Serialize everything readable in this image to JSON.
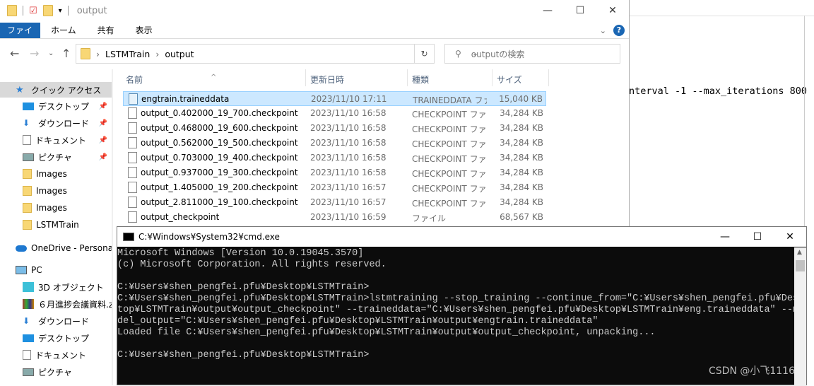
{
  "background_doc": {
    "text": "nterval -1 --max_iterations 800"
  },
  "explorer": {
    "title": "output",
    "ribbon_tabs": [
      "ファイル",
      "ホーム",
      "共有",
      "表示"
    ],
    "breadcrumb": [
      "LSTMTrain",
      "output"
    ],
    "search_placeholder": "outputの検索",
    "sidebar": [
      {
        "label": "クイック アクセス",
        "icon": "star-icon",
        "selected": true
      },
      {
        "label": "デスクトップ",
        "icon": "desktop-icon",
        "pinned": true
      },
      {
        "label": "ダウンロード",
        "icon": "download-icon",
        "pinned": true
      },
      {
        "label": "ドキュメント",
        "icon": "document-icon",
        "pinned": true
      },
      {
        "label": "ピクチャ",
        "icon": "picture-icon",
        "pinned": true
      },
      {
        "label": "Images",
        "icon": "folder-icon"
      },
      {
        "label": "Images",
        "icon": "folder-icon"
      },
      {
        "label": "Images",
        "icon": "folder-icon"
      },
      {
        "label": "LSTMTrain",
        "icon": "folder-icon"
      },
      {
        "label": "OneDrive - Personal",
        "icon": "cloud-icon"
      },
      {
        "label": "PC",
        "icon": "pc-icon"
      },
      {
        "label": "3D オブジェクト",
        "icon": "cube-icon"
      },
      {
        "label": "６月進捗会議資料.z",
        "icon": "archive-icon"
      },
      {
        "label": "ダウンロード",
        "icon": "download-icon"
      },
      {
        "label": "デスクトップ",
        "icon": "desktop-icon"
      },
      {
        "label": "ドキュメント",
        "icon": "document-icon"
      },
      {
        "label": "ピクチャ",
        "icon": "picture-icon"
      }
    ],
    "columns": [
      "名前",
      "更新日時",
      "種類",
      "サイズ"
    ],
    "files": [
      {
        "name": "engtrain.traineddata",
        "date": "2023/11/10 17:11",
        "type": "TRAINEDDATA ファイル",
        "size": "15,040 KB",
        "selected": true
      },
      {
        "name": "output_0.402000_19_700.checkpoint",
        "date": "2023/11/10 16:58",
        "type": "CHECKPOINT ファイル",
        "size": "34,284 KB"
      },
      {
        "name": "output_0.468000_19_600.checkpoint",
        "date": "2023/11/10 16:58",
        "type": "CHECKPOINT ファイル",
        "size": "34,284 KB"
      },
      {
        "name": "output_0.562000_19_500.checkpoint",
        "date": "2023/11/10 16:58",
        "type": "CHECKPOINT ファイル",
        "size": "34,284 KB"
      },
      {
        "name": "output_0.703000_19_400.checkpoint",
        "date": "2023/11/10 16:58",
        "type": "CHECKPOINT ファイル",
        "size": "34,284 KB"
      },
      {
        "name": "output_0.937000_19_300.checkpoint",
        "date": "2023/11/10 16:58",
        "type": "CHECKPOINT ファイル",
        "size": "34,284 KB"
      },
      {
        "name": "output_1.405000_19_200.checkpoint",
        "date": "2023/11/10 16:57",
        "type": "CHECKPOINT ファイル",
        "size": "34,284 KB"
      },
      {
        "name": "output_2.811000_19_100.checkpoint",
        "date": "2023/11/10 16:57",
        "type": "CHECKPOINT ファイル",
        "size": "34,284 KB"
      },
      {
        "name": "output_checkpoint",
        "date": "2023/11/10 16:59",
        "type": "ファイル",
        "size": "68,567 KB"
      }
    ]
  },
  "cmd": {
    "title": "C:¥Windows¥System32¥cmd.exe",
    "lines": [
      "Microsoft Windows [Version 10.0.19045.3570]",
      "(c) Microsoft Corporation. All rights reserved.",
      "",
      "C:¥Users¥shen_pengfei.pfu¥Desktop¥LSTMTrain>",
      "C:¥Users¥shen_pengfei.pfu¥Desktop¥LSTMTrain>lstmtraining --stop_training --continue_from=\"C:¥Users¥shen_pengfei.pfu¥Desk",
      "top¥LSTMTrain¥output¥output_checkpoint\" --traineddata=\"C:¥Users¥shen_pengfei.pfu¥Desktop¥LSTMTrain¥eng.traineddata\" --mo",
      "del_output=\"C:¥Users¥shen_pengfei.pfu¥Desktop¥LSTMTrain¥output¥engtrain.traineddata\"",
      "Loaded file C:¥Users¥shen_pengfei.pfu¥Desktop¥LSTMTrain¥output¥output_checkpoint, unpacking...",
      "",
      "C:¥Users¥shen_pengfei.pfu¥Desktop¥LSTMTrain>"
    ]
  },
  "watermark": "CSDN @小飞1116",
  "colors": {
    "ribbon_file": "#1a66b3",
    "selection": "#cce8ff",
    "console_bg": "#0c0c0c",
    "console_fg": "#cccccc"
  }
}
